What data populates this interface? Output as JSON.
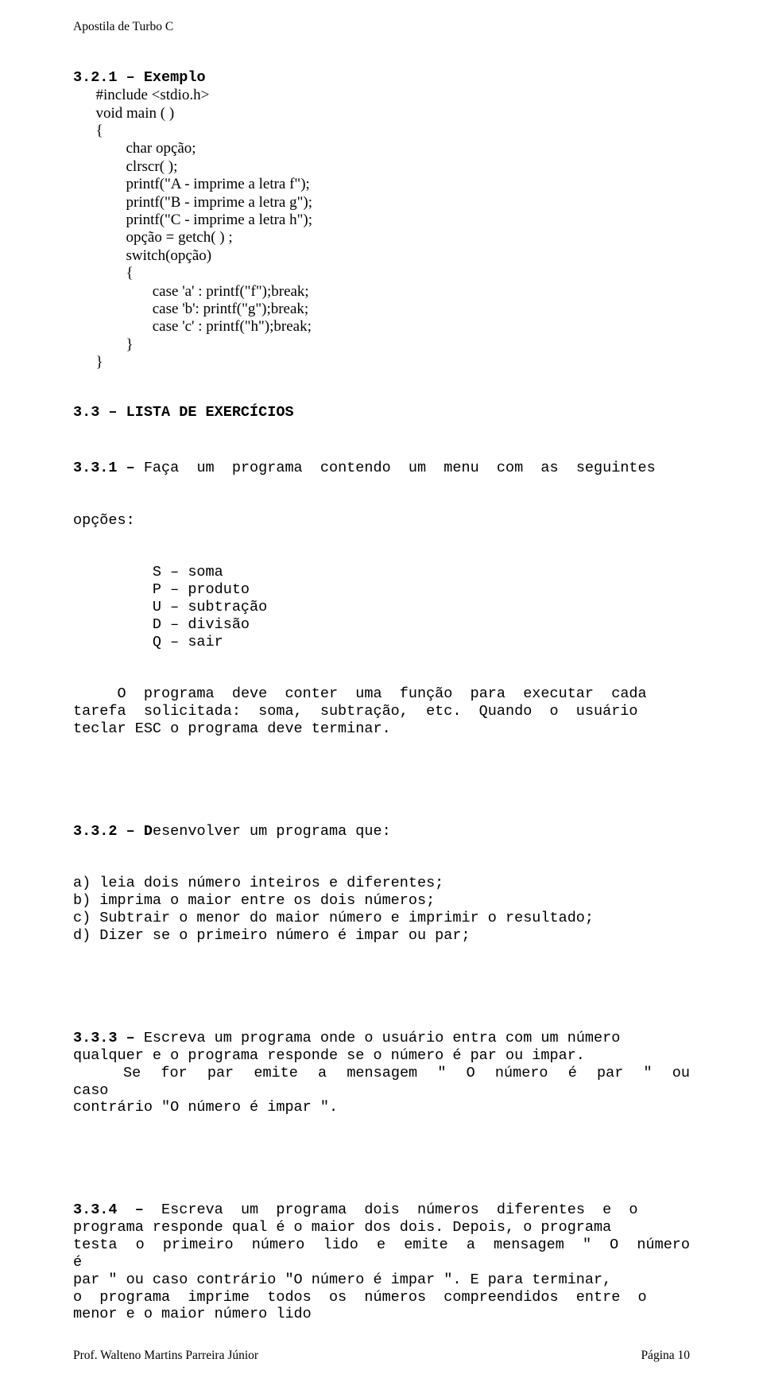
{
  "header": {
    "running": "Apostila de Turbo C"
  },
  "example": {
    "title_num": "3.2.1 – ",
    "title_word": "Exemplo",
    "code": "      #include <stdio.h>\n      void main ( )\n      {\n              char opção;\n              clrscr( );\n              printf(\"A - imprime a letra f\");\n              printf(\"B - imprime a letra g\");\n              printf(\"C - imprime a letra h\");\n              opção = getch( ) ;\n              switch(opção)\n              {\n                     case 'a' : printf(\"f\");break;\n                     case 'b': printf(\"g\");break;\n                     case 'c' : printf(\"h\");break;\n              }\n      }"
  },
  "list": {
    "heading": "3.3 – LISTA DE EXERCÍCIOS"
  },
  "ex331": {
    "num": "3.3.1 – ",
    "lead_line": "Faça  um  programa  contendo  um  menu  com  as  seguintes",
    "line2": "opções:",
    "menu": "         S – soma\n         P – produto\n         U – subtração\n         D – divisão\n         Q – sair",
    "tail": "     O  programa  deve  conter  uma  função  para  executar  cada\ntarefa  solicitada:  soma,  subtração,  etc.  Quando  o  usuário\nteclar ESC o programa deve terminar."
  },
  "ex332": {
    "num": "3.3.2 – ",
    "lead_bold": "D",
    "lead_rest": "esenvolver um programa que:",
    "body": "a) leia dois número inteiros e diferentes;\nb) imprima o maior entre os dois números;\nc) Subtrair o menor do maior número e imprimir o resultado;\nd) Dizer se o primeiro número é impar ou par;"
  },
  "ex333": {
    "num": "3.3.3 – ",
    "body": "Escreva um programa onde o usuário entra com um número\nqualquer e o programa responde se o número é par ou impar.\n     Se  for  par  emite  a  mensagem  \"  O  número  é  par  \"  ou  caso\ncontrário \"O número é impar \"."
  },
  "ex334": {
    "num": "3.3.4  –  ",
    "body": "Escreva  um  programa  dois  números  diferentes  e  o\nprograma responde qual é o maior dos dois. Depois, o programa\ntesta  o  primeiro  número  lido  e  emite  a  mensagem  \"  O  número  é\npar \" ou caso contrário \"O número é impar \". E para terminar,\no  programa  imprime  todos  os  números  compreendidos  entre  o\nmenor e o maior número lido"
  },
  "footer": {
    "author": "Prof. Walteno Martins Parreira Júnior",
    "page": "Página 10"
  }
}
